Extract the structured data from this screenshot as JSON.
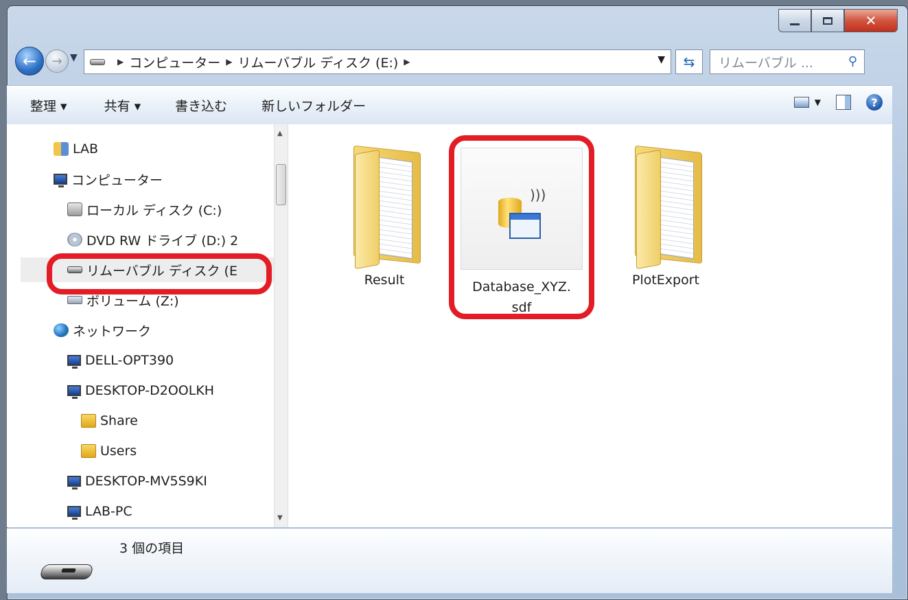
{
  "address_bar": {
    "crumbs": [
      "コンピューター",
      "リムーバブル ディスク (E:)"
    ],
    "search_placeholder": "リムーバブル ..."
  },
  "toolbar": {
    "organize": "整理 ▾",
    "share": "共有 ▾",
    "burn": "書き込む",
    "new_folder": "新しいフォルダー"
  },
  "nav_tree": {
    "items": [
      {
        "label": "LAB",
        "icon": "user-folder-icon"
      },
      {
        "label": "コンピューター",
        "icon": "computer-icon"
      },
      {
        "label": "ローカル ディスク (C:)",
        "icon": "local-disk-icon"
      },
      {
        "label": "DVD RW ドライブ (D:) 2",
        "icon": "dvd-drive-icon"
      },
      {
        "label": "リムーバブル ディスク (E",
        "icon": "removable-drive-icon",
        "selected": true
      },
      {
        "label": "ボリューム (Z:)",
        "icon": "volume-icon"
      },
      {
        "label": "ネットワーク",
        "icon": "network-icon"
      },
      {
        "label": "DELL-OPT390",
        "icon": "computer-icon"
      },
      {
        "label": "DESKTOP-D2OOLKH",
        "icon": "computer-icon"
      },
      {
        "label": "Share",
        "icon": "shared-folder-icon"
      },
      {
        "label": "Users",
        "icon": "shared-folder-icon"
      },
      {
        "label": "DESKTOP-MV5S9KI",
        "icon": "computer-icon"
      },
      {
        "label": "LAB-PC",
        "icon": "computer-icon"
      }
    ]
  },
  "content": {
    "items": [
      {
        "name": "Result",
        "type": "folder"
      },
      {
        "name_line1": "Database_XYZ.",
        "name_line2": "sdf",
        "type": "database-file",
        "highlighted": true
      },
      {
        "name": "PlotExport",
        "type": "folder"
      }
    ]
  },
  "status_bar": {
    "count": "3 個の項目"
  },
  "colors": {
    "highlight": "#e21d25",
    "window_frame": "#b2c7e0"
  }
}
